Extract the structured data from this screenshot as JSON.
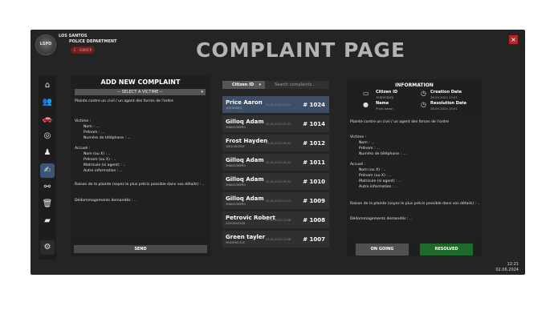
{
  "header": {
    "logo_text": "LSPD",
    "department_line1": "LOS SANTOS",
    "department_line2": "POLICE DEPARTMENT",
    "badge": "C - 1000CP",
    "page_title": "COMPLAINT PAGE",
    "close": "×"
  },
  "sidebar": {
    "items": [
      {
        "icon": "home-icon",
        "glyph": "⌂"
      },
      {
        "icon": "users-icon",
        "glyph": "👥"
      },
      {
        "icon": "car-icon",
        "glyph": "🚗"
      },
      {
        "icon": "binoculars-icon",
        "glyph": "◎"
      },
      {
        "icon": "officer-icon",
        "glyph": "♟"
      },
      {
        "icon": "complaint-icon",
        "glyph": "✍"
      },
      {
        "icon": "handcuffs-icon",
        "glyph": "⚯"
      },
      {
        "icon": "trash-icon",
        "glyph": "🗑"
      },
      {
        "icon": "folder-icon",
        "glyph": "▰"
      },
      {
        "icon": "settings-icon",
        "glyph": "⚙"
      }
    ]
  },
  "add_complaint": {
    "title": "ADD NEW COMPLAINT",
    "victim_select": "-- SELECT A VICTIME --",
    "text_lines": [
      "Plainte contre un civil / un agent des forces de l'ordre",
      "Victime :",
      "Nom : ...",
      "Prénom : ...",
      "Numéro de téléphone : ...",
      "Accusé :",
      "Nom (ou X) : ..",
      "Prénom (ou X) : ..",
      "Matricule (si agent) : ..",
      "Autre information : ..",
      "Raison de la plainte (soyez le plus précis possible dans vos détails) : ..",
      "Dédommagements demandés : .."
    ],
    "send_label": "SEND"
  },
  "complaint_list": {
    "filter_label": "Citizen ID",
    "search_placeholder": "Search complaints...",
    "items": [
      {
        "name": "Price Aaron",
        "cid": "1FJK9ODJFJJ",
        "date": "01.05.2024 12:21",
        "number": "# 1024"
      },
      {
        "name": "Gilloq Adam",
        "cid": "3NKKQGMPRH",
        "date": "05.05.2024 12:43",
        "number": "# 1014"
      },
      {
        "name": "Frost Hayden",
        "cid": "1MQL3KQRSF",
        "date": "05.05.2024 16:02",
        "number": "# 1012"
      },
      {
        "name": "Gilloq Adam",
        "cid": "3NKKQGMPRH",
        "date": "05.05.2024 14:02",
        "number": "# 1011"
      },
      {
        "name": "Gilloq Adam",
        "cid": "3NKKQGMPRH",
        "date": "05.05.2024 15:32",
        "number": "# 1010"
      },
      {
        "name": "Gilloq Adam",
        "cid": "3NKKQGMPRH",
        "date": "05.05.2024 11:13",
        "number": "# 1009"
      },
      {
        "name": "Petrovic Robert",
        "cid": "2GVQRH0X2B",
        "date": "05.05.2024 13:08",
        "number": "# 1008"
      },
      {
        "name": "Green tayler",
        "cid": "9RGMHKL32E",
        "date": "05.05.2024 13:08",
        "number": "# 1007"
      }
    ]
  },
  "information": {
    "title": "INFORMATION",
    "citizen_id_label": "Citizen ID",
    "citizen_id_value": "1FJK9ODJFJJ",
    "creation_label": "Creation Date",
    "creation_value": "26.05.2024 13:51",
    "name_label": "Name",
    "name_value": "Price Aaron",
    "resolution_label": "Resolution Date",
    "resolution_value": "26.05.2024 15:51",
    "text_lines": [
      "Plainte contre un civil / un agent des forces de l'ordre",
      "Victime :",
      "Nom : ...",
      "Prénom : ...",
      "Numéro de téléphone : ...",
      "Accusé :",
      "Nom (ou X) : ..",
      "Prénom (ou X) : ..",
      "Matricule (si agent) : ..",
      "Autre information : ..",
      "Raison de la plainte (soyez le plus précis possible dans vos détails) : ..",
      "Dédommagements demandés : .."
    ],
    "ongoing_label": "ON GOING",
    "resolved_label": "RESOLVED"
  },
  "clock": {
    "time": "12:21",
    "date": "02.06.2024"
  }
}
